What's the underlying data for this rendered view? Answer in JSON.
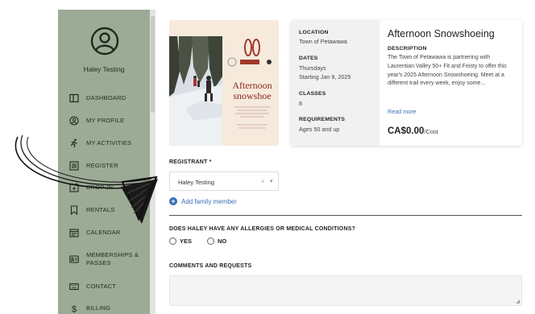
{
  "sidebar": {
    "user_name": "Haley Testing",
    "items": [
      {
        "label": "DASHBOARD",
        "icon": "columns-icon"
      },
      {
        "label": "MY PROFILE",
        "icon": "person-circle-icon"
      },
      {
        "label": "MY ACTIVITIES",
        "icon": "running-icon"
      },
      {
        "label": "REGISTER",
        "icon": "list-icon"
      },
      {
        "label": "DROP-IN",
        "icon": "calendar-plus-icon"
      },
      {
        "label": "RENTALS",
        "icon": "bookmark-icon"
      },
      {
        "label": "CALENDAR",
        "icon": "calendar-icon"
      },
      {
        "label": "MEMBERSHIPS & PASSES",
        "icon": "id-card-icon"
      },
      {
        "label": "CONTACT",
        "icon": "keyboard-icon"
      },
      {
        "label": "BILLING",
        "icon": "dollar-icon"
      }
    ]
  },
  "poster": {
    "title_line1": "Afternoon",
    "title_line2": "snowshoe"
  },
  "event": {
    "location_label": "LOCATION",
    "location_value": "Town of Petawawa",
    "dates_label": "DATES",
    "dates_line1": "Thursdays",
    "dates_line2": "Starting Jan 9, 2025",
    "classes_label": "CLASSES",
    "classes_value": "8",
    "requirements_label": "REQUIREMENTS",
    "requirements_value": "Ages 50 and up",
    "title": "Afternoon Snowshoeing",
    "description_label": "DESCRIPTION",
    "description": "The Town of Petawawa is partnering with Laurentian Valley 50+ Fit and Feisty to offer this year's 2025 Afternoon Snowshoeing. Meet at a different trail every week, enjoy some...",
    "read_more": "Read more",
    "price": "CA$0.00",
    "price_unit": "/Cost"
  },
  "form": {
    "registrant_label": "REGISTRANT *",
    "registrant_value": "Haley Testing",
    "clear_glyph": "×",
    "caret_glyph": "▾",
    "add_family_icon": "+",
    "add_family": "Add family member",
    "allergies_question": "DOES HALEY HAVE ANY ALLERGIES OR MEDICAL CONDITIONS?",
    "yes_label": "YES",
    "no_label": "NO",
    "comments_label": "COMMENTS AND REQUESTS"
  }
}
